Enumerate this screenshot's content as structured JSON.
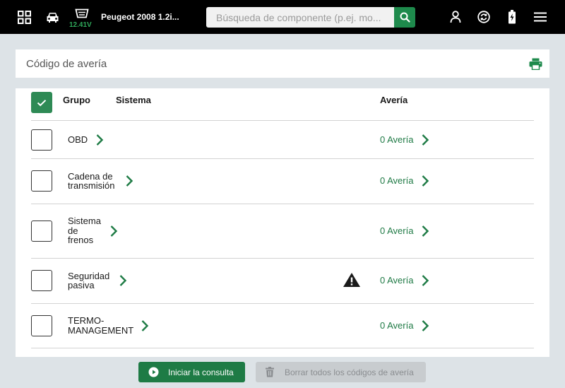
{
  "topbar": {
    "vehicle_name": "Peugeot 2008 1.2i...",
    "voltage": "12.41V",
    "search_placeholder": "Búsqueda de componente (p.ej. mo...",
    "icons": [
      "grid-icon",
      "car-icon",
      "obd-connector-icon",
      "search-icon",
      "user-icon",
      "sync-icon",
      "battery-charge-icon",
      "menu-icon"
    ]
  },
  "code_card": {
    "title": "Código de avería",
    "print_icon": "printer-icon"
  },
  "table": {
    "headers": {
      "group": "Grupo",
      "system": "Sistema",
      "fault": "Avería"
    },
    "rows": [
      {
        "label_lines": [
          "OBD"
        ],
        "fault": "0 Avería",
        "warning": false
      },
      {
        "label_lines": [
          "Cadena de",
          "transmisión"
        ],
        "fault": "0 Avería",
        "warning": false
      },
      {
        "label_lines": [
          "Sistema",
          "de",
          "frenos"
        ],
        "fault": "0 Avería",
        "warning": false
      },
      {
        "label_lines": [
          "Seguridad",
          "pasiva"
        ],
        "fault": "0 Avería",
        "warning": true
      },
      {
        "label_lines": [
          "TERMO-",
          "MANAGEMENT"
        ],
        "fault": "0 Avería",
        "warning": false
      }
    ]
  },
  "actions": {
    "start_label": "Iniciar la consulta",
    "clear_label": "Borrar todos los códigos de avería"
  },
  "colors": {
    "accent": "#1e8a4c",
    "topbar_bg": "#000000",
    "background": "#dde3e7",
    "voltage": "#2fa85a",
    "fault_text": "#1f7a45",
    "disabled_button": "#c8cccf"
  }
}
